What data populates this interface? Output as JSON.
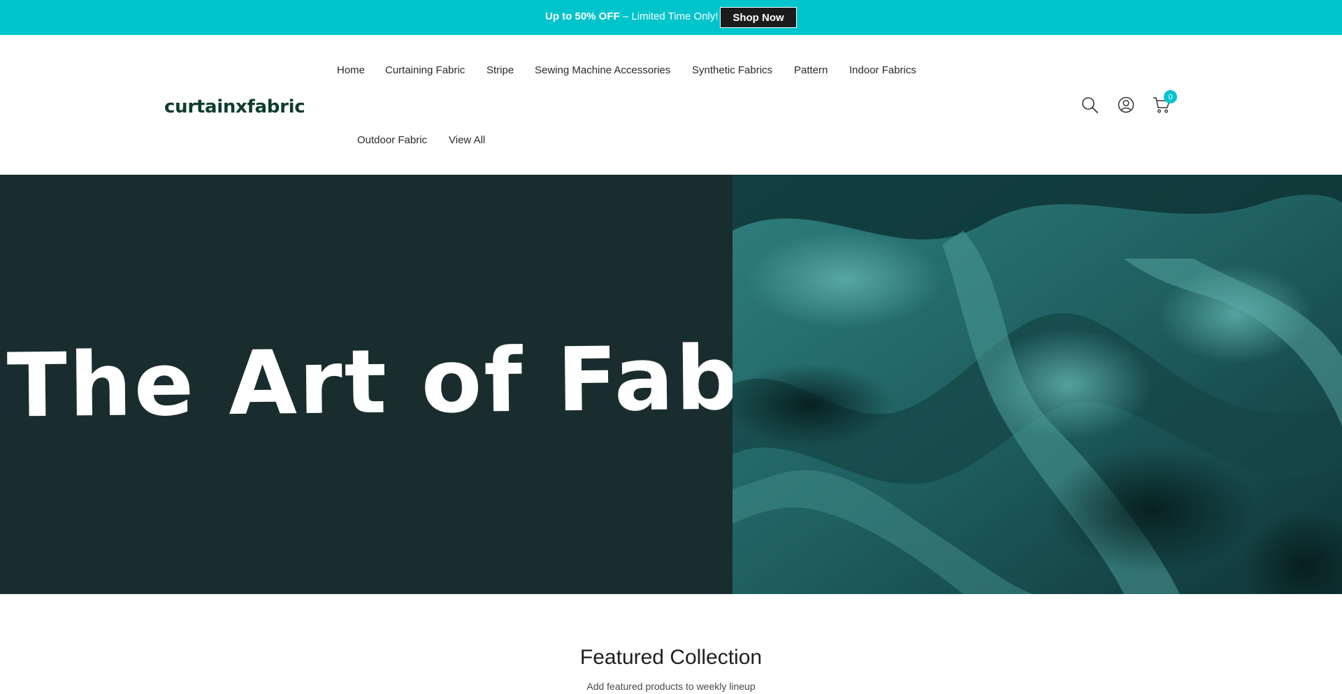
{
  "announcement": {
    "highlight": "Up to 50% OFF",
    "text": " – Limited Time Only!",
    "button_label": "Shop Now",
    "background": "#00c4cc"
  },
  "header": {
    "logo": "curtainxfabric",
    "nav": [
      {
        "label": "Home"
      },
      {
        "label": "Curtaining Fabric"
      },
      {
        "label": "Stripe"
      },
      {
        "label": "Sewing Machine Accessories"
      },
      {
        "label": "Synthetic Fabrics"
      },
      {
        "label": "Pattern"
      },
      {
        "label": "Indoor Fabrics"
      },
      {
        "label": "Outdoor Fabric"
      },
      {
        "label": "View All"
      }
    ],
    "icons": {
      "search": "search-icon",
      "account": "user-icon",
      "cart": "cart-icon"
    },
    "cart_count": "0"
  },
  "hero": {
    "title": "The Art of Fabric",
    "background": "#1a2d2e"
  },
  "featured": {
    "title": "Featured Collection",
    "subtitle": "Add featured products to weekly lineup"
  }
}
